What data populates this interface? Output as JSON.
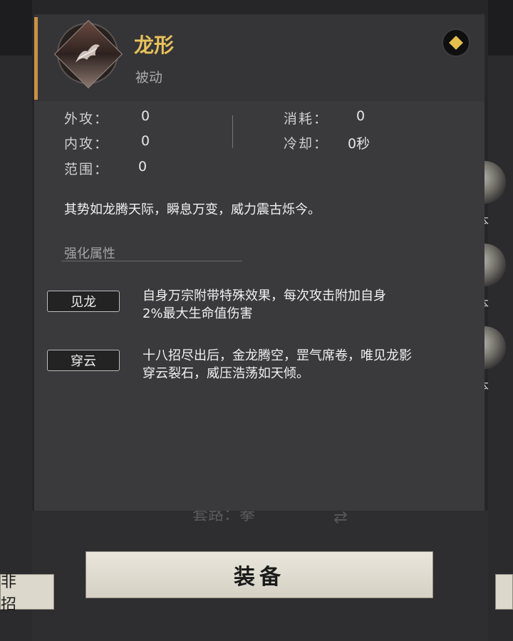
{
  "skill": {
    "name": "龙形",
    "type": "被动",
    "description": "其势如龙腾天际，瞬息万变，威力震古烁今。"
  },
  "stats": {
    "outer_attack_label": "外攻：",
    "outer_attack_value": "0",
    "inner_attack_label": "内攻：",
    "inner_attack_value": "0",
    "range_label": "范围：",
    "range_value": "0",
    "cost_label": "消耗：",
    "cost_value": "0",
    "cooldown_label": "冷却：",
    "cooldown_value": "0秒"
  },
  "enhance": {
    "title": "强化属性",
    "items": [
      {
        "tag": "见龙",
        "text_line1": "自身万宗附带特殊效果，每次攻击附加自身",
        "text_line2": "2%最大生命值伤害"
      },
      {
        "tag": "穿云",
        "text_line1": "十八招尽出后，金龙腾空，罡气席卷，唯见龙影",
        "text_line2": "穿云裂石，威压浩荡如天倾。"
      }
    ]
  },
  "background": {
    "route_label": "套路：拳",
    "side_labels": [
      "护本",
      "护本",
      "护本"
    ]
  },
  "buttons": {
    "equip": "装备",
    "left_partial": "非招"
  },
  "colors": {
    "accent": "#c79244",
    "skill_name": "#e8c25a"
  }
}
